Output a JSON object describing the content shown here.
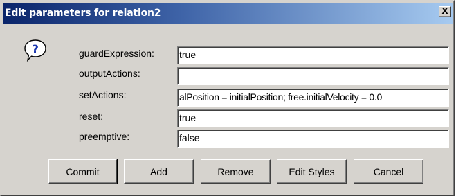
{
  "window": {
    "title": "Edit parameters for relation2",
    "close_label": "X"
  },
  "icons": {
    "dialog_icon": "question-icon",
    "close": "close-icon"
  },
  "fields": [
    {
      "label": "guardExpression:",
      "value": "true"
    },
    {
      "label": "outputActions:",
      "value": ""
    },
    {
      "label": "setActions:",
      "value": "alPosition = initialPosition; free.initialVelocity = 0.0"
    },
    {
      "label": "reset:",
      "value": "true"
    },
    {
      "label": "preemptive:",
      "value": "false"
    }
  ],
  "buttons": {
    "commit": "Commit",
    "add": "Add",
    "remove": "Remove",
    "edit_styles": "Edit Styles",
    "cancel": "Cancel"
  },
  "colors": {
    "title_gradient_start": "#0a246a",
    "title_gradient_end": "#a6caf0",
    "dialog_background": "#d6d3ce"
  }
}
